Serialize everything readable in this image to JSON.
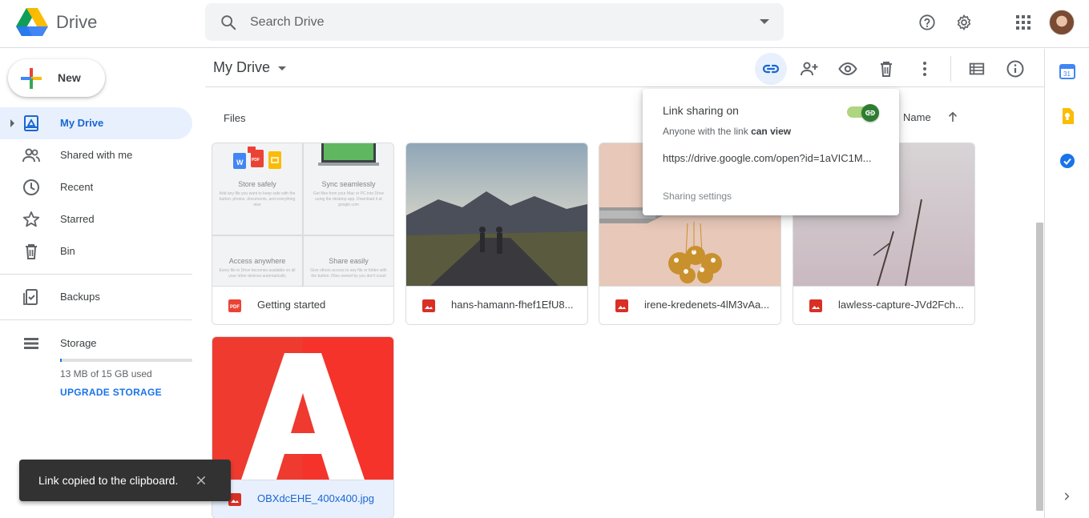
{
  "app": {
    "name": "Drive"
  },
  "search": {
    "placeholder": "Search Drive"
  },
  "header_icons": [
    "help-icon",
    "settings-icon",
    "apps-grid-icon",
    "avatar"
  ],
  "sidebar": {
    "new_label": "New",
    "items": [
      {
        "label": "My Drive",
        "icon": "my-drive-icon",
        "active": true
      },
      {
        "label": "Shared with me",
        "icon": "shared-people-icon"
      },
      {
        "label": "Recent",
        "icon": "clock-icon"
      },
      {
        "label": "Starred",
        "icon": "star-icon"
      },
      {
        "label": "Bin",
        "icon": "trash-icon"
      },
      {
        "label": "Backups",
        "icon": "backups-icon"
      },
      {
        "label": "Storage",
        "icon": "storage-icon"
      }
    ],
    "storage_used": "13 MB of 15 GB used",
    "storage_fraction": 0.001,
    "upgrade_label": "UPGRADE STORAGE"
  },
  "main": {
    "title": "My Drive",
    "section_label": "Files",
    "sort_label": "Name",
    "toolbar_icons": [
      "get-link-icon",
      "share-icon",
      "preview-icon",
      "remove-icon",
      "more-icon",
      "list-view-icon",
      "details-icon"
    ]
  },
  "getting_started": {
    "cells": [
      {
        "title": "Store safely",
        "desc": "Add any file you want to keep safe with the button: photos, documents, and everything else"
      },
      {
        "title": "Sync seamlessly",
        "desc": "Get files from your Mac or PC into Drive using the desktop app. Download it at google.com"
      },
      {
        "title": "Access anywhere",
        "desc": "Every file in Drive becomes available on all your other devices automatically"
      },
      {
        "title": "Share easily",
        "desc": "Give others access to any file or folder with the button. Files owned by you don't count"
      }
    ]
  },
  "files": [
    {
      "name": "Getting started",
      "type": "pdf"
    },
    {
      "name": "hans-hamann-fhef1EfU8...",
      "type": "image"
    },
    {
      "name": "irene-kredenets-4lM3vAa...",
      "type": "image"
    },
    {
      "name": "lawless-capture-JVd2Fch...",
      "type": "image"
    },
    {
      "name": "OBXdcEHE_400x400.jpg",
      "type": "image",
      "selected": true
    }
  ],
  "share_popup": {
    "title": "Link sharing on",
    "subtitle_prefix": "Anyone with the link",
    "subtitle_perm": "can view",
    "url": "https://drive.google.com/open?id=1aVIC1M...",
    "settings_label": "Sharing settings",
    "enabled": true
  },
  "snackbar": {
    "message": "Link copied to the clipboard."
  },
  "rail": {
    "calendar_date": "31",
    "icons": [
      "calendar-icon",
      "keep-icon",
      "tasks-icon",
      "chevron-right-icon"
    ]
  },
  "colors": {
    "accent": "#1a73e8",
    "active_bg": "#e8f0fe",
    "pdf_red": "#ea4335",
    "toggle_green": "#2e7d32"
  }
}
